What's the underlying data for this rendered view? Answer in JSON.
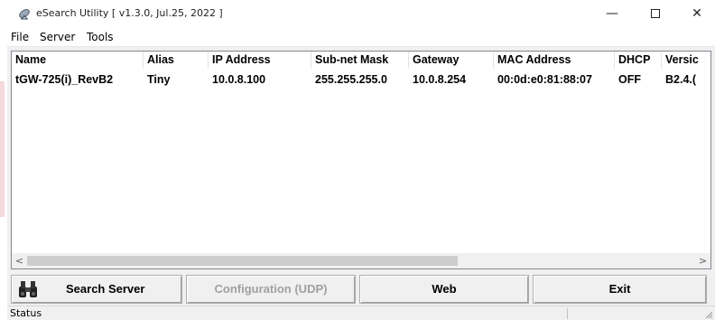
{
  "window": {
    "title": "eSearch Utility [ v1.3.0, Jul.25, 2022 ]",
    "minimize": "—",
    "close": "✕"
  },
  "menu": [
    "File",
    "Server",
    "Tools"
  ],
  "columns": [
    "Name",
    "Alias",
    "IP Address",
    "Sub-net Mask",
    "Gateway",
    "MAC Address",
    "DHCP",
    "Versic"
  ],
  "rows": [
    [
      "tGW-725(i)_RevB2",
      "Tiny",
      "10.0.8.100",
      "255.255.255.0",
      "10.0.8.254",
      "00:0d:e0:81:88:07",
      "OFF",
      "B2.4.("
    ]
  ],
  "scrollbar": {
    "left_arrow": "<",
    "right_arrow": ">"
  },
  "buttons": {
    "search": "Search Server",
    "config": "Configuration (UDP)",
    "web": "Web",
    "exit": "Exit"
  },
  "status": {
    "text": "Status"
  },
  "icons": {
    "title": "satellite-dish-icon",
    "search": "binoculars-icon"
  }
}
